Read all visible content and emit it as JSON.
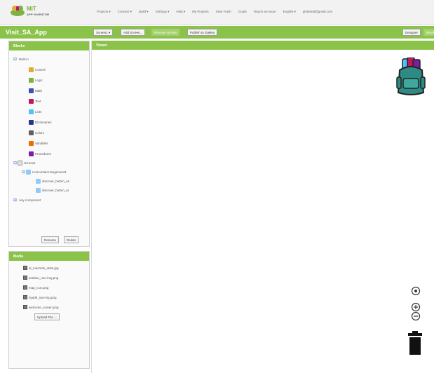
{
  "logo": {
    "title": "MIT",
    "subtitle": "APP INVENTOR"
  },
  "topnav": [
    "Projects ▾",
    "Connect ▾",
    "Build ▾",
    "Settings ▾",
    "Help ▾",
    "My Projects",
    "View Trash",
    "Guide",
    "Report an Issue",
    "English ▾",
    "globeted@gmail.com"
  ],
  "project": {
    "name": "Visit_SA_App",
    "screen_dropdown": "Screen1 ▾",
    "add_screen": "Add Screen...",
    "remove_screen": "Remove Screen",
    "publish": "Publish to Gallery",
    "designer": "Designer",
    "blocks_tab": "Blocks"
  },
  "blocks_panel": {
    "title": "Blocks",
    "builtin_label": "Built-in",
    "builtin": [
      {
        "label": "Control",
        "color": "#e5a83a"
      },
      {
        "label": "Logic",
        "color": "#7cb342"
      },
      {
        "label": "Math",
        "color": "#3f51b5"
      },
      {
        "label": "Text",
        "color": "#c2185b"
      },
      {
        "label": "Lists",
        "color": "#4fc3f7"
      },
      {
        "label": "Dictionaries",
        "color": "#283593"
      },
      {
        "label": "Colors",
        "color": "#616161"
      },
      {
        "label": "Variables",
        "color": "#ef6c00"
      },
      {
        "label": "Procedures",
        "color": "#7b1fa2"
      }
    ],
    "screen_label": "Screen1",
    "arrangement_label": "HorizontalArrangement1",
    "buttons": [
      "discover_button_en",
      "discover_button_ar"
    ],
    "any_component": "Any component",
    "rename": "Rename",
    "delete": "Delete"
  },
  "media_panel": {
    "title": "Media",
    "files": [
      "al_masmak_state.jpg",
      "arabian_nav-img.png",
      "map_icon.png",
      "riyadh_nav-img.png",
      "welcome_screen.png"
    ],
    "upload": "Upload File ..."
  },
  "viewer": {
    "title": "Viewer"
  }
}
